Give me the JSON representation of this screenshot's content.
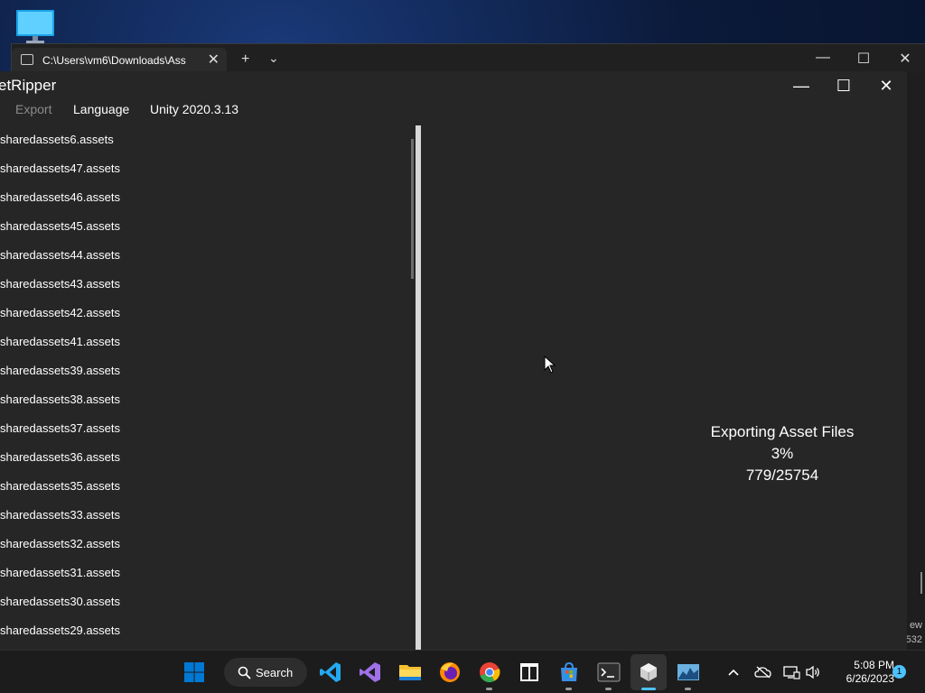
{
  "desktop": {
    "icon_name": "this-pc-icon"
  },
  "terminal": {
    "tab_title": "C:\\Users\\vm6\\Downloads\\Ass",
    "tab_close": "✕",
    "new_tab": "+",
    "tab_dropdown": "⌄",
    "side_text_1": "ew",
    "side_text_2": "532",
    "window_controls": {
      "minimize": "—",
      "maximize": "☐",
      "close": "✕"
    }
  },
  "app": {
    "title": "etRipper",
    "window_controls": {
      "minimize": "—",
      "maximize": "☐",
      "close": "✕"
    },
    "menu": {
      "export": "Export",
      "language": "Language",
      "unity": "Unity 2020.3.13"
    },
    "files": [
      "sharedassets6.assets",
      "sharedassets47.assets",
      "sharedassets46.assets",
      "sharedassets45.assets",
      "sharedassets44.assets",
      "sharedassets43.assets",
      "sharedassets42.assets",
      "sharedassets41.assets",
      "sharedassets39.assets",
      "sharedassets38.assets",
      "sharedassets37.assets",
      "sharedassets36.assets",
      "sharedassets35.assets",
      "sharedassets33.assets",
      "sharedassets32.assets",
      "sharedassets31.assets",
      "sharedassets30.assets",
      "sharedassets29.assets"
    ],
    "progress": {
      "status": "Exporting Asset Files",
      "percent": "3%",
      "count": "779/25754"
    }
  },
  "taskbar": {
    "search_label": "Search",
    "time": "5:08 PM",
    "date": "6/26/2023",
    "notification_count": "1",
    "accent": "#0078d4"
  }
}
